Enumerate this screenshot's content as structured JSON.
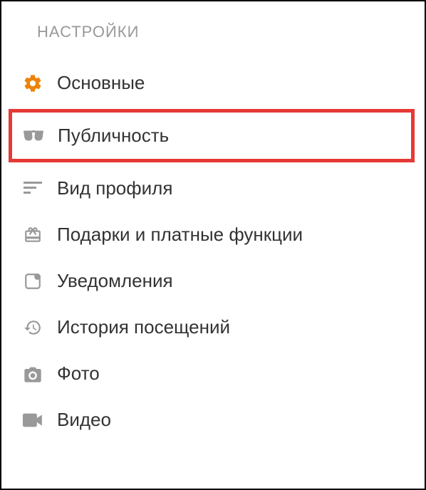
{
  "header": "НАСТРОЙКИ",
  "items": [
    {
      "id": "general",
      "label": "Основные"
    },
    {
      "id": "publicity",
      "label": "Публичность"
    },
    {
      "id": "profile-view",
      "label": "Вид профиля"
    },
    {
      "id": "gifts",
      "label": "Подарки и платные функции"
    },
    {
      "id": "notifications",
      "label": "Уведомления"
    },
    {
      "id": "history",
      "label": "История посещений"
    },
    {
      "id": "photo",
      "label": "Фото"
    },
    {
      "id": "video",
      "label": "Видео"
    }
  ]
}
